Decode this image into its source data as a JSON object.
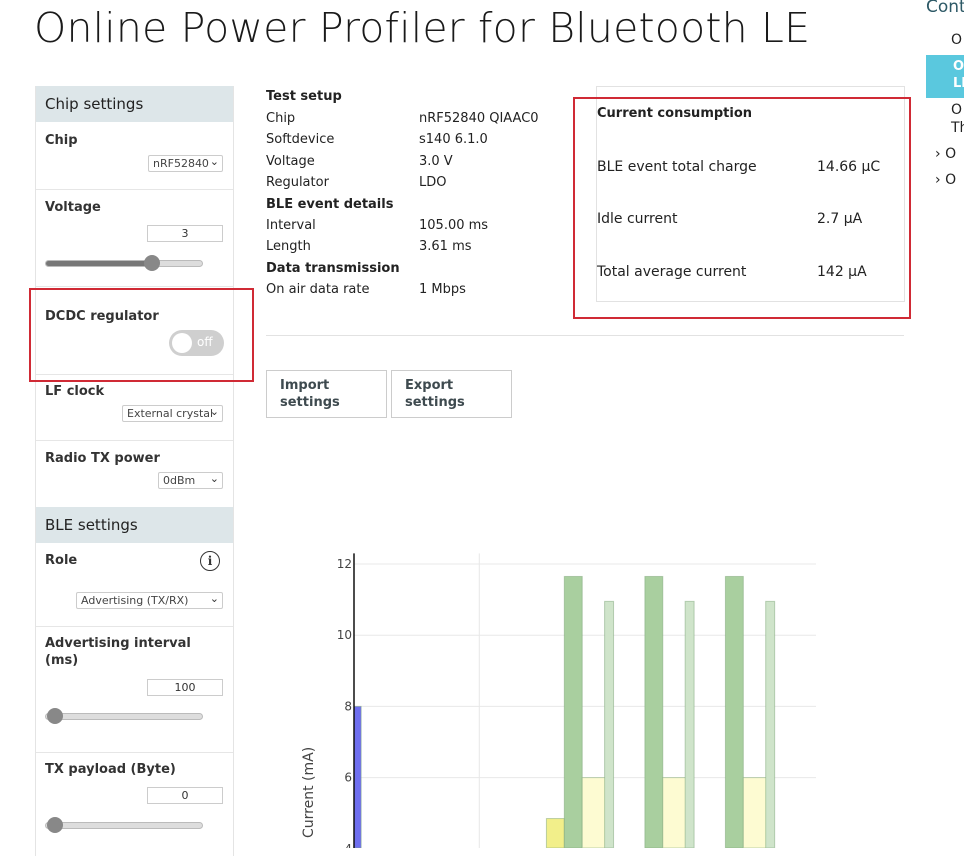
{
  "page": {
    "title": "Online Power Profiler for Bluetooth LE"
  },
  "toc": {
    "heading": "Cont",
    "items": [
      "O",
      "O",
      "LE",
      "O",
      "Th",
      "O",
      "O"
    ]
  },
  "chip_settings": {
    "heading": "Chip settings",
    "chip": {
      "label": "Chip",
      "value": "nRF52840"
    },
    "voltage": {
      "label": "Voltage",
      "value": "3",
      "slider_fraction": 0.66
    },
    "dcdc": {
      "label": "DCDC regulator",
      "state": "off"
    },
    "lf_clock": {
      "label": "LF clock",
      "value": "External crystal"
    },
    "radio_tx": {
      "label": "Radio TX power",
      "value": "0dBm"
    }
  },
  "ble_settings": {
    "heading": "BLE settings",
    "role": {
      "label": "Role",
      "value": "Advertising (TX/RX)"
    },
    "adv_interval": {
      "label_line1": "Advertising interval",
      "label_line2": "(ms)",
      "value": "100",
      "slider_fraction": 0.0
    },
    "tx_payload": {
      "label": "TX payload (Byte)",
      "value": "0",
      "slider_fraction": 0.0
    }
  },
  "test_setup": {
    "heading": "Test setup",
    "rows": [
      {
        "k": "Chip",
        "v": "nRF52840 QIAAC0"
      },
      {
        "k": "Softdevice",
        "v": "s140 6.1.0"
      },
      {
        "k": "Voltage",
        "v": "3.0 V"
      },
      {
        "k": "Regulator",
        "v": "LDO"
      }
    ],
    "ble_heading": "BLE event details",
    "ble_rows": [
      {
        "k": "Interval",
        "v": "105.00 ms"
      },
      {
        "k": "Length",
        "v": "3.61 ms"
      }
    ],
    "data_heading": "Data transmission",
    "data_rows": [
      {
        "k": "On air data rate",
        "v": "1 Mbps"
      }
    ]
  },
  "current_consumption": {
    "heading": "Current consumption",
    "rows": [
      {
        "k": "BLE event total charge",
        "v": "14.66 μC"
      },
      {
        "k": "Idle current",
        "v": "2.7 μA"
      },
      {
        "k": "Total average current",
        "v": "142 μA"
      }
    ]
  },
  "buttons": {
    "import": [
      "Import",
      "settings"
    ],
    "export": [
      "Export",
      "settings"
    ]
  },
  "colors": {
    "highlight": "#d02a35",
    "section_bg": "#dde6e9",
    "toc_active": "#5ac8de"
  },
  "chart_data": {
    "type": "bar",
    "ylabel": "Current (mA)",
    "yticks": [
      12,
      10,
      8,
      6,
      4
    ],
    "ylim": [
      4,
      12.3
    ],
    "grid": true,
    "bars": [
      {
        "x": 0.0,
        "w": 0.08,
        "value": 8.0,
        "color": "#6f6ff0"
      },
      {
        "x": 2.15,
        "w": 0.2,
        "value": 4.85,
        "color": "#f2ef8a"
      },
      {
        "x": 2.35,
        "w": 0.2,
        "value": 11.65,
        "color": "#a9cf9f"
      },
      {
        "x": 2.55,
        "w": 0.3,
        "value": 6.0,
        "color": "#fdfbd2"
      },
      {
        "x": 2.8,
        "w": 0.1,
        "value": 10.95,
        "color": "#cfe4ca"
      },
      {
        "x": 3.25,
        "w": 0.2,
        "value": 11.65,
        "color": "#a9cf9f"
      },
      {
        "x": 3.45,
        "w": 0.3,
        "value": 6.0,
        "color": "#fdfbd2"
      },
      {
        "x": 3.7,
        "w": 0.1,
        "value": 10.95,
        "color": "#cfe4ca"
      },
      {
        "x": 4.15,
        "w": 0.2,
        "value": 11.65,
        "color": "#a9cf9f"
      },
      {
        "x": 4.35,
        "w": 0.3,
        "value": 6.0,
        "color": "#fdfbd2"
      },
      {
        "x": 4.6,
        "w": 0.1,
        "value": 10.95,
        "color": "#cfe4ca"
      }
    ]
  }
}
